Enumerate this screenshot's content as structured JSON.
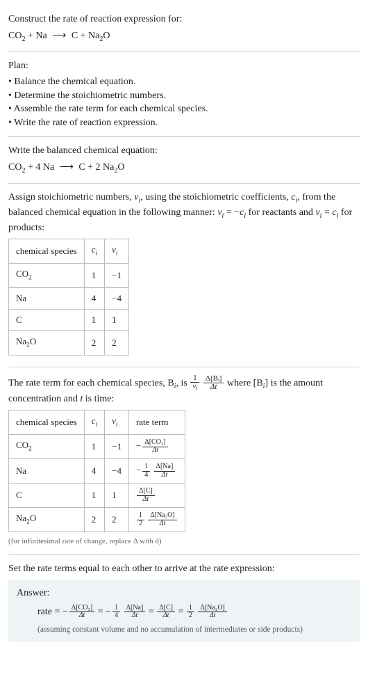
{
  "prompt": {
    "title": "Construct the rate of reaction expression for:",
    "eq": "CO₂ + Na ⟶ C + Na₂O"
  },
  "plan": {
    "heading": "Plan:",
    "items": [
      "Balance the chemical equation.",
      "Determine the stoichiometric numbers.",
      "Assemble the rate term for each chemical species.",
      "Write the rate of reaction expression."
    ]
  },
  "balanced": {
    "heading": "Write the balanced chemical equation:",
    "eq": "CO₂ + 4 Na ⟶ C + 2 Na₂O"
  },
  "stoich": {
    "text_parts": {
      "a": "Assign stoichiometric numbers, ",
      "nu_i": "ν",
      "b": ", using the stoichiometric coefficients, ",
      "c_i": "c",
      "c": ", from the balanced chemical equation in the following manner: ",
      "rel1_lhs": "ν",
      "rel1_eq": " = −",
      "rel1_rhs": "c",
      "d": " for reactants and ",
      "rel2_lhs": "ν",
      "rel2_eq": " = ",
      "rel2_rhs": "c",
      "e": " for products:"
    },
    "table": {
      "headers": [
        "chemical species",
        "cᵢ",
        "νᵢ"
      ],
      "rows": [
        {
          "species": "CO₂",
          "c": "1",
          "nu": "−1"
        },
        {
          "species": "Na",
          "c": "4",
          "nu": "−4"
        },
        {
          "species": "C",
          "c": "1",
          "nu": "1"
        },
        {
          "species": "Na₂O",
          "c": "2",
          "nu": "2"
        }
      ]
    }
  },
  "rateterm": {
    "intro_a": "The rate term for each chemical species, B",
    "intro_b": ", is ",
    "frac1_num": "1",
    "frac1_den": "νᵢ",
    "frac2_num": "Δ[Bᵢ]",
    "frac2_den": "Δt",
    "intro_c": " where [B",
    "intro_d": "] is the amount concentration and ",
    "t_label": "t",
    "intro_e": " is time:",
    "table": {
      "headers": [
        "chemical species",
        "cᵢ",
        "νᵢ",
        "rate term"
      ],
      "rows": [
        {
          "species": "CO₂",
          "c": "1",
          "nu": "−1",
          "rt_prefix": "−",
          "rt_coef_num": "",
          "rt_coef_den": "",
          "rt_num": "Δ[CO₂]",
          "rt_den": "Δt"
        },
        {
          "species": "Na",
          "c": "4",
          "nu": "−4",
          "rt_prefix": "−",
          "rt_coef_num": "1",
          "rt_coef_den": "4",
          "rt_num": "Δ[Na]",
          "rt_den": "Δt"
        },
        {
          "species": "C",
          "c": "1",
          "nu": "1",
          "rt_prefix": "",
          "rt_coef_num": "",
          "rt_coef_den": "",
          "rt_num": "Δ[C]",
          "rt_den": "Δt"
        },
        {
          "species": "Na₂O",
          "c": "2",
          "nu": "2",
          "rt_prefix": "",
          "rt_coef_num": "1",
          "rt_coef_den": "2",
          "rt_num": "Δ[Na₂O]",
          "rt_den": "Δt"
        }
      ]
    },
    "note": "(for infinitesimal rate of change, replace Δ with d)"
  },
  "final": {
    "heading": "Set the rate terms equal to each other to arrive at the rate expression:",
    "answer_label": "Answer:",
    "rate_label": "rate = ",
    "terms": [
      {
        "prefix": "−",
        "coef_num": "",
        "coef_den": "",
        "num": "Δ[CO₂]",
        "den": "Δt"
      },
      {
        "prefix": "−",
        "coef_num": "1",
        "coef_den": "4",
        "num": "Δ[Na]",
        "den": "Δt"
      },
      {
        "prefix": "",
        "coef_num": "",
        "coef_den": "",
        "num": "Δ[C]",
        "den": "Δt"
      },
      {
        "prefix": "",
        "coef_num": "1",
        "coef_den": "2",
        "num": "Δ[Na₂O]",
        "den": "Δt"
      }
    ],
    "eq_sep": " = ",
    "assumption": "(assuming constant volume and no accumulation of intermediates or side products)"
  },
  "glyphs": {
    "sub_i": "i",
    "sub2": "2"
  }
}
